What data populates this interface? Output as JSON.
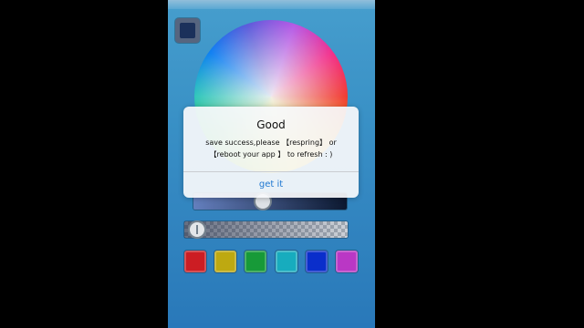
{
  "alert": {
    "title": "Good",
    "message_line1": "save success,please 【respring】 or",
    "message_line2": "【reboot your app 】 to refresh : )",
    "button_label": "get it"
  },
  "picker": {
    "current_color": "#1d3460",
    "brightness_level": 0.45,
    "opacity_level": 0.02,
    "palette": [
      {
        "name": "red",
        "color": "#d71f25"
      },
      {
        "name": "yellow",
        "color": "#c9b312"
      },
      {
        "name": "green",
        "color": "#19a33c"
      },
      {
        "name": "cyan",
        "color": "#19b6c9"
      },
      {
        "name": "blue",
        "color": "#0b31d6"
      },
      {
        "name": "magenta",
        "color": "#c53ad0"
      }
    ]
  }
}
